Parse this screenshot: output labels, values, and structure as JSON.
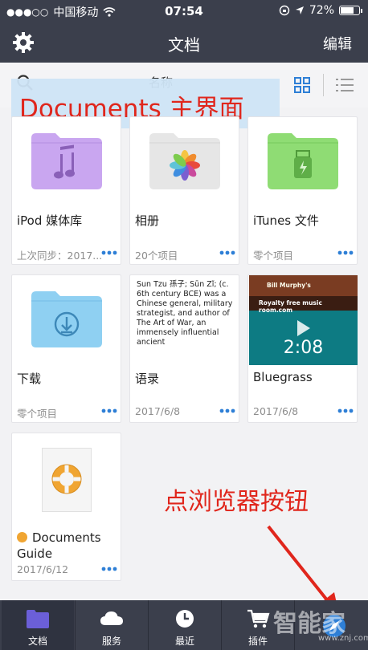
{
  "status": {
    "carrier": "中国移动",
    "time": "07:54",
    "battery": "72%",
    "battery_level": 0.72
  },
  "nav": {
    "title": "文档",
    "edit_label": "编辑"
  },
  "toolbar": {
    "sort_label": "名称"
  },
  "banner": {
    "text": "Documents 主界面"
  },
  "items": [
    {
      "name": "iPod 媒体库",
      "meta": "上次同步：2017...",
      "icon": "music-folder-icon",
      "color": "#c9a6f0"
    },
    {
      "name": "相册",
      "meta": "20个项目",
      "icon": "photos-folder-icon",
      "color": "#e6e6e6"
    },
    {
      "name": "iTunes 文件",
      "meta": "零个项目",
      "icon": "usb-folder-icon",
      "color": "#8fdc74"
    },
    {
      "name": "下载",
      "meta": "零个项目",
      "icon": "download-folder-icon",
      "color": "#8fd0f2"
    },
    {
      "name": "语录",
      "meta": "2017/6/8",
      "icon": "text-file-icon",
      "preview": "Sun Tzu 孫子; Sūn Zǐ; (c. 6th century BCE) was a Chinese general, military strategist, and author of The Art of War, an immensely influential ancient"
    },
    {
      "name": "Bluegrass",
      "meta": "2017/6/8",
      "icon": "video-file-icon",
      "video_duration": "2:08",
      "video_caption": "Royalty free music room.com",
      "video_caption2": "Bill Murphy's"
    },
    {
      "name": "Documents Guide",
      "meta": "2017/6/12",
      "icon": "lifebuoy-icon",
      "dot_color": "#f0a532"
    }
  ],
  "annotation": {
    "text": "点浏览器按钮"
  },
  "tabs": [
    {
      "label": "文档",
      "icon": "folder-icon",
      "active": true
    },
    {
      "label": "服务",
      "icon": "cloud-icon",
      "active": false
    },
    {
      "label": "最近",
      "icon": "clock-icon",
      "active": false
    },
    {
      "label": "插件",
      "icon": "cart-icon",
      "active": false
    }
  ],
  "watermark": {
    "text": "智能家",
    "url": "www.znj.com"
  },
  "colors": {
    "bar": "#3b3f4c",
    "accent": "#2e7fd6",
    "annotation": "#e0261c"
  }
}
